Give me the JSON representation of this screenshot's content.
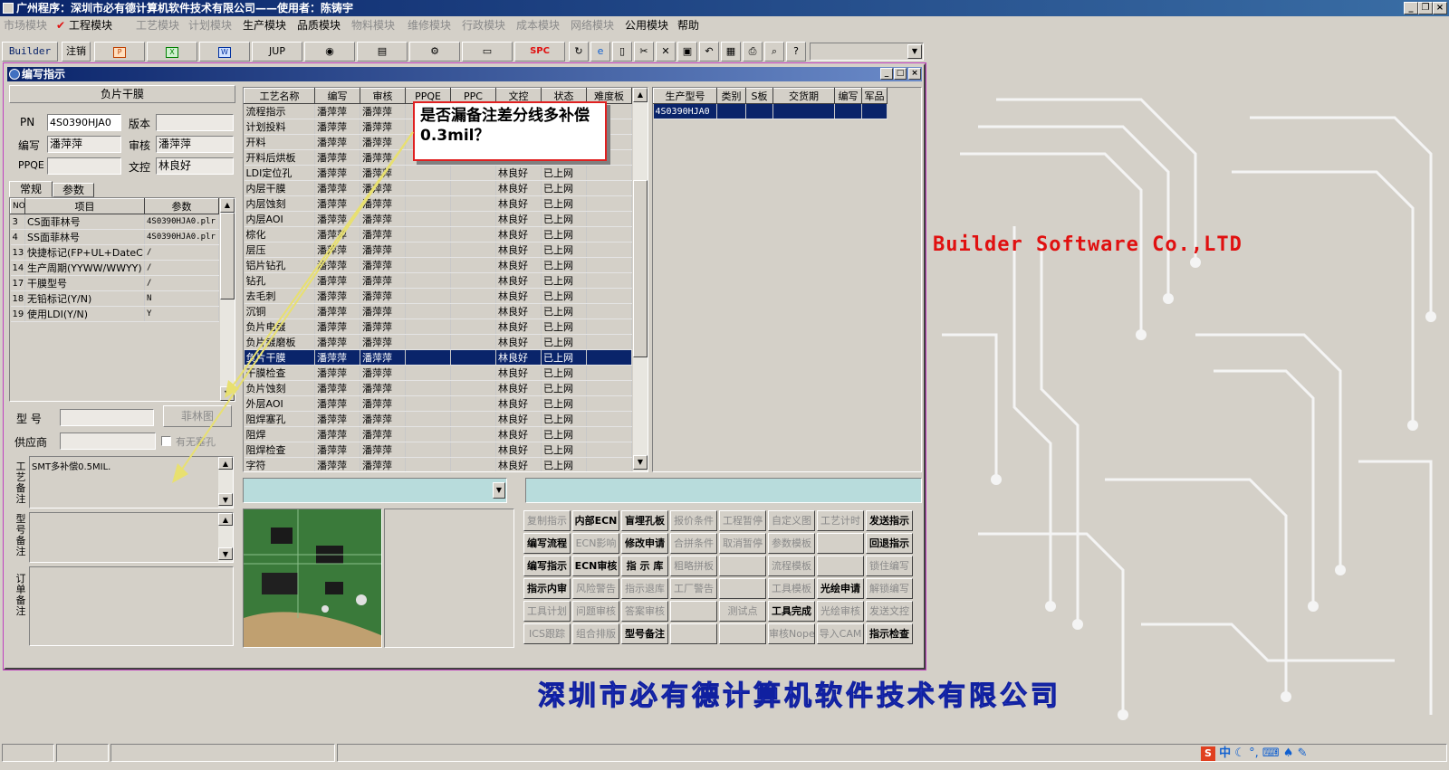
{
  "app": {
    "title": "广州程序：深圳市必有德计算机软件技术有限公司——使用者：陈铸宇"
  },
  "menu": [
    {
      "label": "市场模块",
      "enabled": false
    },
    {
      "label": "工程模块",
      "enabled": true
    },
    {
      "label": "工艺模块",
      "enabled": false
    },
    {
      "label": "计划模块",
      "enabled": false
    },
    {
      "label": "生产模块",
      "enabled": true
    },
    {
      "label": "品质模块",
      "enabled": true
    },
    {
      "label": "物料模块",
      "enabled": false
    },
    {
      "label": "维修模块",
      "enabled": false
    },
    {
      "label": "行政模块",
      "enabled": false
    },
    {
      "label": "成本模块",
      "enabled": false
    },
    {
      "label": "网络模块",
      "enabled": false
    },
    {
      "label": "公用模块",
      "enabled": true
    },
    {
      "label": "帮助",
      "enabled": true
    }
  ],
  "toolbar": {
    "builder": "Builder",
    "logout": "注销",
    "jup": "JUP",
    "spc": "SPC"
  },
  "window": {
    "title": "编写指示"
  },
  "left": {
    "header": "负片干膜",
    "pn_label": "PN",
    "pn_value": "4S0390HJA0",
    "version_label": "版本",
    "version_value": "",
    "writer_label": "编写",
    "writer_value": "潘萍萍",
    "audit_label": "审核",
    "audit_value": "潘萍萍",
    "ppqe_label": "PPQE",
    "ppqe_value": "",
    "doc_label": "文控",
    "doc_value": "林良好",
    "tabs": [
      "常规",
      "参数"
    ],
    "param_headers": [
      "NO",
      "项目",
      "参数"
    ],
    "params": [
      [
        "3",
        "CS面菲林号",
        "4S0390HJA0.plr"
      ],
      [
        "4",
        "SS面菲林号",
        "4S0390HJA0.plr"
      ],
      [
        "13",
        "快捷标记(FP+UL+DateC",
        "/"
      ],
      [
        "14",
        "生产周期(YYWW/WWYY)",
        "/"
      ],
      [
        "17",
        "干膜型号",
        "/"
      ],
      [
        "18",
        "无铅标记(Y/N)",
        "N"
      ],
      [
        "19",
        "使用LDI(Y/N)",
        "Y"
      ]
    ],
    "model_label": "型  号",
    "model_value": "",
    "film_button": "菲林图",
    "supplier_label": "供应商",
    "supplier_value": "",
    "hole_check": "有无塞孔",
    "process_note_label": "工艺备注",
    "process_note_value": "SMT多补偿0.5MIL.",
    "model_note_label": "型号备注",
    "model_note_value": "",
    "order_note_label": "订单备注",
    "order_note_value": ""
  },
  "process_table": {
    "headers": [
      "工艺名称",
      "编写",
      "审核",
      "PPQE",
      "PPC",
      "文控",
      "状态",
      "难度板"
    ],
    "rows": [
      [
        "流程指示",
        "潘萍萍",
        "潘萍萍",
        "",
        "",
        "",
        "",
        ""
      ],
      [
        "计划投料",
        "潘萍萍",
        "潘萍萍",
        "",
        "",
        "",
        "",
        ""
      ],
      [
        "开料",
        "潘萍萍",
        "潘萍萍",
        "",
        "",
        "",
        "",
        ""
      ],
      [
        "开料后烘板",
        "潘萍萍",
        "潘萍萍",
        "",
        "",
        "",
        "",
        ""
      ],
      [
        "LDI定位孔",
        "潘萍萍",
        "潘萍萍",
        "",
        "",
        "林良好",
        "已上网",
        ""
      ],
      [
        "内层干膜",
        "潘萍萍",
        "潘萍萍",
        "",
        "",
        "林良好",
        "已上网",
        ""
      ],
      [
        "内层蚀刻",
        "潘萍萍",
        "潘萍萍",
        "",
        "",
        "林良好",
        "已上网",
        ""
      ],
      [
        "内层AOI",
        "潘萍萍",
        "潘萍萍",
        "",
        "",
        "林良好",
        "已上网",
        ""
      ],
      [
        "棕化",
        "潘萍萍",
        "潘萍萍",
        "",
        "",
        "林良好",
        "已上网",
        ""
      ],
      [
        "层压",
        "潘萍萍",
        "潘萍萍",
        "",
        "",
        "林良好",
        "已上网",
        ""
      ],
      [
        "铝片钻孔",
        "潘萍萍",
        "潘萍萍",
        "",
        "",
        "林良好",
        "已上网",
        ""
      ],
      [
        "钻孔",
        "潘萍萍",
        "潘萍萍",
        "",
        "",
        "林良好",
        "已上网",
        ""
      ],
      [
        "去毛刺",
        "潘萍萍",
        "潘萍萍",
        "",
        "",
        "林良好",
        "已上网",
        ""
      ],
      [
        "沉铜",
        "潘萍萍",
        "潘萍萍",
        "",
        "",
        "林良好",
        "已上网",
        ""
      ],
      [
        "负片电镀",
        "潘萍萍",
        "潘萍萍",
        "",
        "",
        "林良好",
        "已上网",
        ""
      ],
      [
        "负片镀磨板",
        "潘萍萍",
        "潘萍萍",
        "",
        "",
        "林良好",
        "已上网",
        ""
      ],
      [
        "负片干膜",
        "潘萍萍",
        "潘萍萍",
        "",
        "",
        "林良好",
        "已上网",
        ""
      ],
      [
        "干膜检查",
        "潘萍萍",
        "潘萍萍",
        "",
        "",
        "林良好",
        "已上网",
        ""
      ],
      [
        "负片蚀刻",
        "潘萍萍",
        "潘萍萍",
        "",
        "",
        "林良好",
        "已上网",
        ""
      ],
      [
        "外层AOI",
        "潘萍萍",
        "潘萍萍",
        "",
        "",
        "林良好",
        "已上网",
        ""
      ],
      [
        "阻焊塞孔",
        "潘萍萍",
        "潘萍萍",
        "",
        "",
        "林良好",
        "已上网",
        ""
      ],
      [
        "阻焊",
        "潘萍萍",
        "潘萍萍",
        "",
        "",
        "林良好",
        "已上网",
        ""
      ],
      [
        "阻焊检查",
        "潘萍萍",
        "潘萍萍",
        "",
        "",
        "林良好",
        "已上网",
        ""
      ],
      [
        "字符",
        "潘萍萍",
        "潘萍萍",
        "",
        "",
        "林良好",
        "已上网",
        ""
      ]
    ],
    "selected_index": 16
  },
  "model_table": {
    "headers": [
      "生产型号",
      "类别",
      "S板",
      "交货期",
      "编写",
      "军品"
    ],
    "rows": [
      [
        "4S0390HJA0",
        "",
        "",
        "",
        "",
        ""
      ]
    ]
  },
  "callout": {
    "text": "是否漏备注差分线多补偿0.3mil？"
  },
  "buttons": [
    [
      {
        "l": "复制指示",
        "e": false
      },
      {
        "l": "内部ECN",
        "e": true
      },
      {
        "l": "盲埋孔板",
        "e": true
      },
      {
        "l": "报价条件",
        "e": false
      },
      {
        "l": "工程暂停",
        "e": false
      },
      {
        "l": "自定义图",
        "e": false
      },
      {
        "l": "工艺计时",
        "e": false
      },
      {
        "l": "发送指示",
        "e": true
      }
    ],
    [
      {
        "l": "编写流程",
        "e": true
      },
      {
        "l": "ECN影响",
        "e": false
      },
      {
        "l": "修改申请",
        "e": true
      },
      {
        "l": "合拼条件",
        "e": false
      },
      {
        "l": "取消暂停",
        "e": false
      },
      {
        "l": "参数模板",
        "e": false
      },
      {
        "l": "",
        "e": false
      },
      {
        "l": "回退指示",
        "e": true
      }
    ],
    [
      {
        "l": "编写指示",
        "e": true
      },
      {
        "l": "ECN审核",
        "e": true
      },
      {
        "l": "指 示 库",
        "e": true
      },
      {
        "l": "粗略拼板",
        "e": false
      },
      {
        "l": "",
        "e": false
      },
      {
        "l": "流程模板",
        "e": false
      },
      {
        "l": "",
        "e": false
      },
      {
        "l": "锁住编写",
        "e": false
      }
    ],
    [
      {
        "l": "指示内审",
        "e": true
      },
      {
        "l": "风险警告",
        "e": false
      },
      {
        "l": "指示退库",
        "e": false
      },
      {
        "l": "工厂警告",
        "e": false
      },
      {
        "l": "",
        "e": false
      },
      {
        "l": "工具模板",
        "e": false
      },
      {
        "l": "光绘申请",
        "e": true
      },
      {
        "l": "解锁编写",
        "e": false
      }
    ],
    [
      {
        "l": "工具计划",
        "e": false
      },
      {
        "l": "问题审核",
        "e": false
      },
      {
        "l": "答案审核",
        "e": false
      },
      {
        "l": "",
        "e": false
      },
      {
        "l": "测试点",
        "e": false
      },
      {
        "l": "工具完成",
        "e": true
      },
      {
        "l": "光绘审核",
        "e": false
      },
      {
        "l": "发送文控",
        "e": false
      }
    ],
    [
      {
        "l": "ICS跟踪",
        "e": false
      },
      {
        "l": "组合排版",
        "e": false
      },
      {
        "l": "型号备注",
        "e": true
      },
      {
        "l": "",
        "e": false
      },
      {
        "l": "",
        "e": false
      },
      {
        "l": "审核Nope",
        "e": false
      },
      {
        "l": "导入CAM",
        "e": false
      },
      {
        "l": "指示检查",
        "e": true
      }
    ]
  ],
  "brand": {
    "en": "Builder Software Co.,LTD",
    "cn": "深圳市必有德计算机软件技术有限公司"
  },
  "colors": {
    "title_bar": "#0a246a",
    "selection": "#0a246a",
    "callout_border": "#e02020",
    "brand_en": "#e01010",
    "brand_cn": "#3848d8",
    "arrow": "#e8e070"
  },
  "status_icons": [
    "sogou-s-icon",
    "中",
    "moon-icon",
    "degree-icon",
    "keyboard-icon",
    "shirt-icon",
    "wrench-icon"
  ]
}
